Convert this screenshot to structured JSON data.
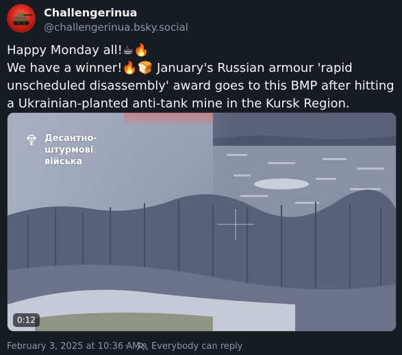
{
  "author": {
    "name": "Challengerinua",
    "handle": "@challengerinua.bsky.social",
    "avatar_icon": "tank-avatar-icon"
  },
  "post": {
    "lines": [
      "Happy Monday all!☕🔥",
      "We have a winner!🔥🍞 January's  Russian armour 'rapid unscheduled disassembly' award goes to this BMP  after hitting a Ukrainian-planted anti-tank mine in the Kursk Region."
    ]
  },
  "video": {
    "watermark": "Десантно-штурмові війська",
    "watermark_icon": "parachute-icon",
    "duration": "0:12"
  },
  "footer": {
    "date": "February 3, 2025 at 10:36 AM",
    "separator": "·",
    "reply_icon": "people-icon",
    "reply_setting": "Everybody can reply"
  },
  "colors": {
    "background": "#171c22",
    "text": "#f1f3f5",
    "muted": "#8a96a6"
  }
}
